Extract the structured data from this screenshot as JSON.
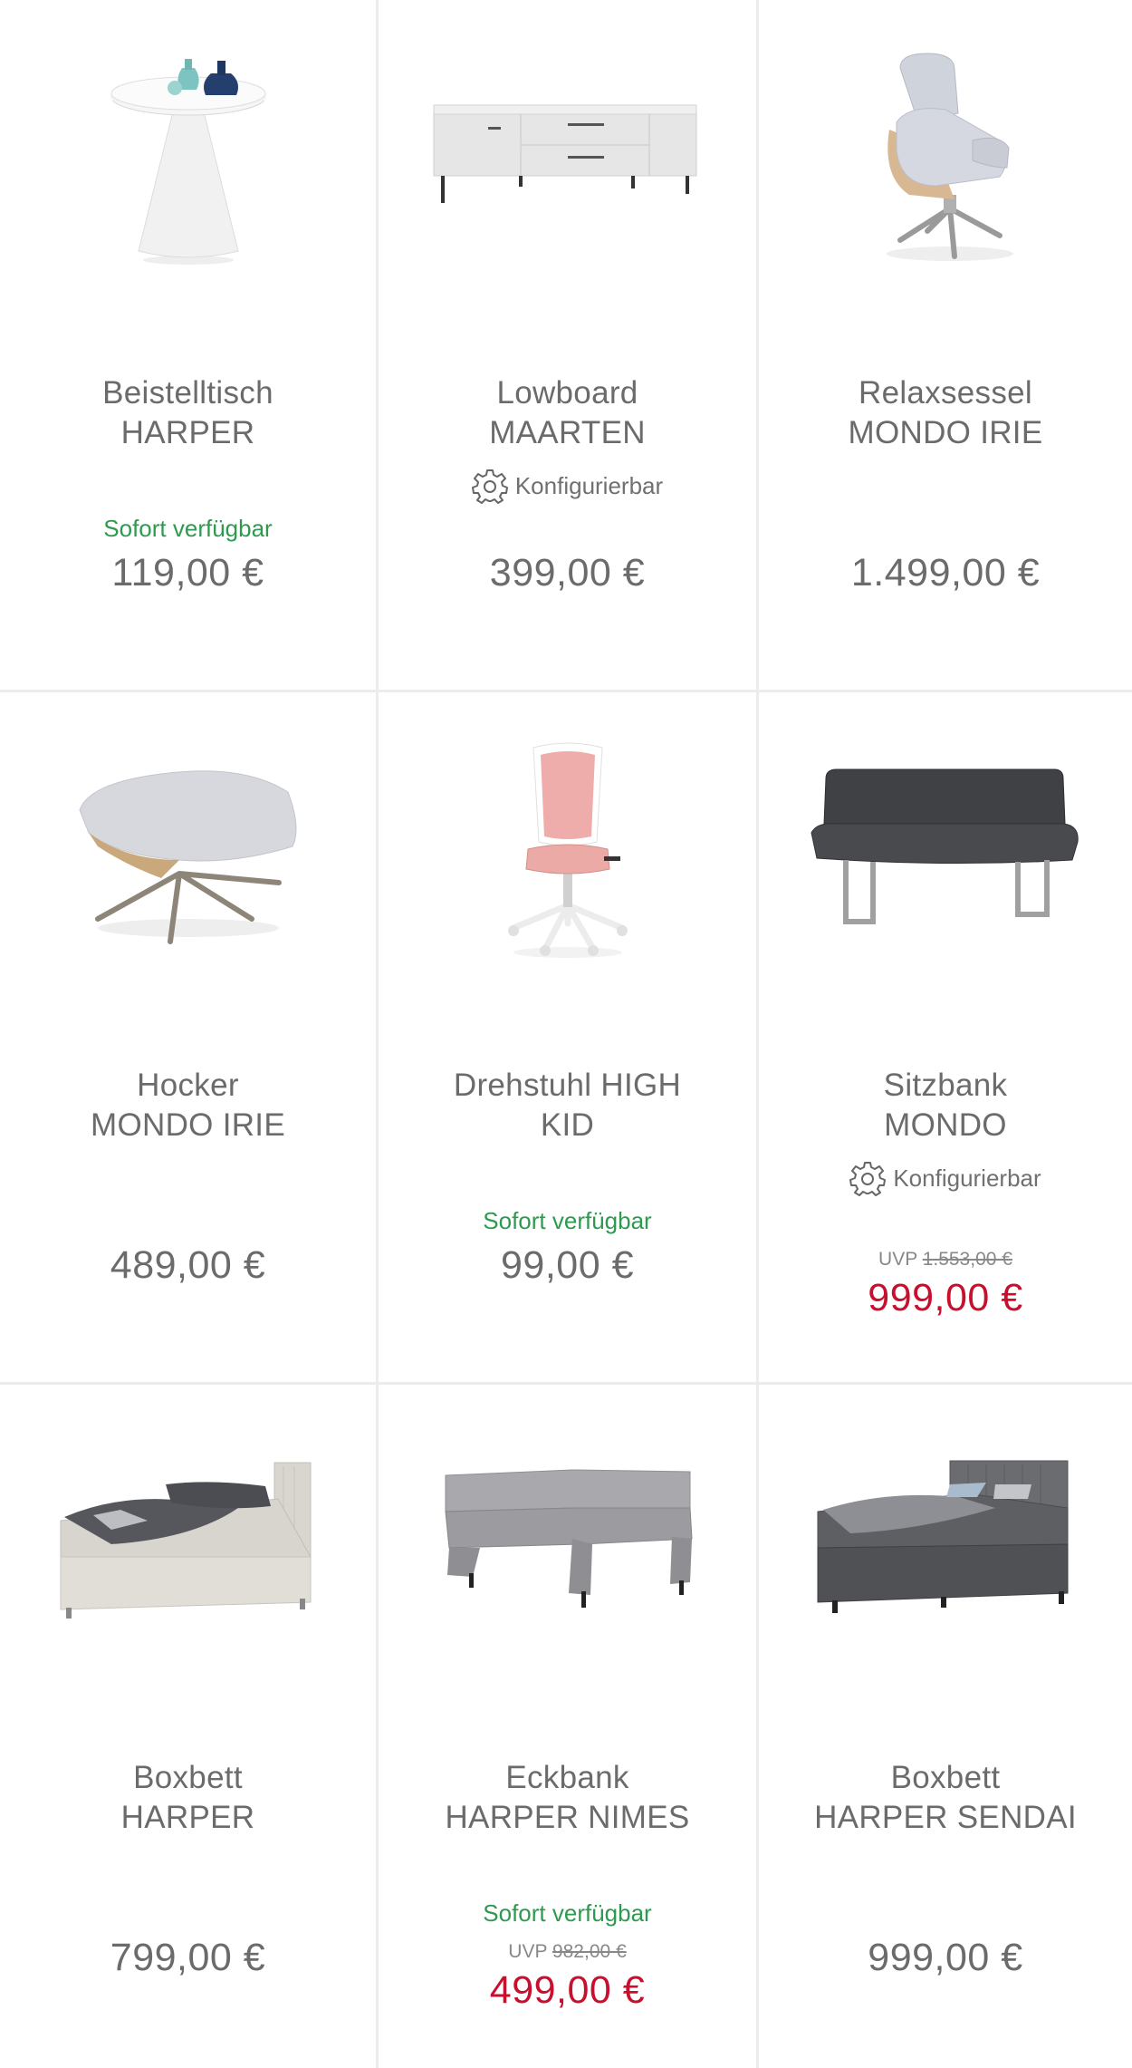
{
  "colors": {
    "available": "#2e9a4f",
    "sale_price": "#c8102e",
    "text": "#6b6b6b",
    "divider": "#ececec"
  },
  "products": [
    {
      "name": "Beistelltisch\nHARPER",
      "image": "side-table",
      "config": "",
      "availability": "Sofort verfügbar",
      "uvp_label": "",
      "uvp_price": "",
      "price": "119,00 €"
    },
    {
      "name": "Lowboard\nMAARTEN",
      "image": "lowboard",
      "config": "Konfigurierbar",
      "availability": "",
      "uvp_label": "",
      "uvp_price": "",
      "price": "399,00 €"
    },
    {
      "name": "Relaxsessel\nMONDO IRIE",
      "image": "relax-chair",
      "config": "",
      "availability": "",
      "uvp_label": "",
      "uvp_price": "",
      "price": "1.499,00 €"
    },
    {
      "name": "Hocker\nMONDO IRIE",
      "image": "ottoman",
      "config": "",
      "availability": "",
      "uvp_label": "",
      "uvp_price": "",
      "price": "489,00 €"
    },
    {
      "name": "Drehstuhl HIGH\nKID",
      "image": "desk-chair",
      "config": "",
      "availability": "Sofort verfügbar",
      "uvp_label": "",
      "uvp_price": "",
      "price": "99,00 €"
    },
    {
      "name": "Sitzbank\nMONDO",
      "image": "bench",
      "config": "Konfigurierbar",
      "availability": "",
      "uvp_label": "UVP",
      "uvp_price": "1.553,00 €",
      "price": "999,00 €"
    },
    {
      "name": "Boxbett\nHARPER",
      "image": "boxbed-light",
      "config": "",
      "availability": "",
      "uvp_label": "",
      "uvp_price": "",
      "price": "799,00 €"
    },
    {
      "name": "Eckbank\nHARPER NIMES",
      "image": "corner-bench",
      "config": "",
      "availability": "Sofort verfügbar",
      "uvp_label": "UVP",
      "uvp_price": "982,00 €",
      "price": "499,00 €"
    },
    {
      "name": "Boxbett\nHARPER SENDAI",
      "image": "boxbed-dark",
      "config": "",
      "availability": "",
      "uvp_label": "",
      "uvp_price": "",
      "price": "999,00 €"
    }
  ]
}
